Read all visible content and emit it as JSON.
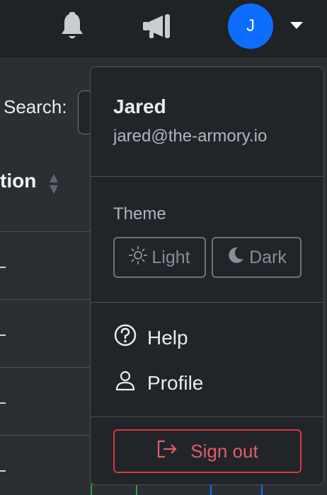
{
  "header": {
    "notifications_icon": "bell-icon",
    "announcements_icon": "megaphone-icon",
    "avatar_initial": "J",
    "avatar_color": "#0d6efd",
    "dropdown_caret_icon": "caret-down-icon"
  },
  "table": {
    "search_label": "Search:",
    "column_header_partial": "tion",
    "row_placeholder": "–"
  },
  "user_menu": {
    "name": "Jared",
    "email": "jared@the-armory.io",
    "theme_label": "Theme",
    "theme_options": [
      {
        "label": "Light",
        "icon": "sun-icon"
      },
      {
        "label": "Dark",
        "icon": "moon-icon"
      }
    ],
    "items": [
      {
        "label": "Help",
        "icon": "question-circle-icon"
      },
      {
        "label": "Profile",
        "icon": "person-icon"
      }
    ],
    "sign_out_label": "Sign out",
    "sign_out_color": "#dc3545"
  }
}
